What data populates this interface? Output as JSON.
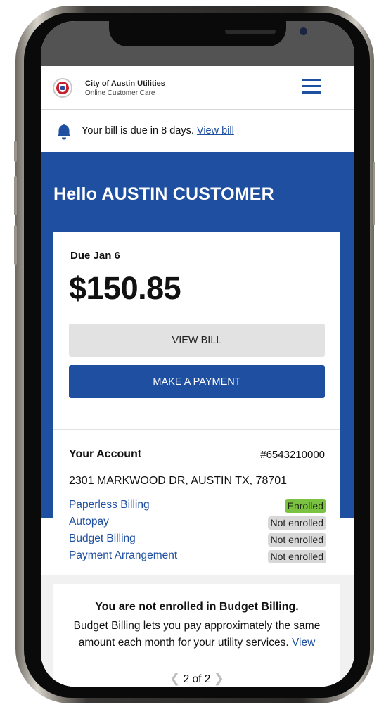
{
  "header": {
    "brand_name": "City of Austin Utilities",
    "brand_sub": "Online Customer Care",
    "menu_icon": "hamburger-menu-icon"
  },
  "alert": {
    "icon": "bell-icon",
    "text": "Your bill is due in 8 days.",
    "link": "View bill"
  },
  "hero": {
    "greeting": "Hello AUSTIN CUSTOMER"
  },
  "bill": {
    "due_label": "Due Jan 6",
    "amount": "$150.85",
    "view_bill_button": "VIEW BILL",
    "pay_button": "MAKE A PAYMENT"
  },
  "account": {
    "title": "Your Account",
    "number": "#6543210000",
    "address": "2301 MARKWOOD DR, AUSTIN TX, 78701",
    "programs": [
      {
        "name": "Paperless Billing",
        "status": "Enrolled"
      },
      {
        "name": "Autopay",
        "status": "Not enrolled"
      },
      {
        "name": "Budget Billing",
        "status": "Not enrolled"
      },
      {
        "name": "Payment Arrangement",
        "status": "Not enrolled"
      }
    ]
  },
  "promo": {
    "title": "You are not enrolled in Budget Billing.",
    "body": "Budget Billing lets you pay approximately the same amount each month for your utility services.",
    "link": "View",
    "pager": "2 of 2",
    "prev_icon": "chevron-left-icon",
    "next_icon": "chevron-right-icon"
  },
  "colors": {
    "brand_blue": "#1f4fa0",
    "enrolled_green": "#7cc242",
    "badge_gray": "#d8d8d8"
  }
}
